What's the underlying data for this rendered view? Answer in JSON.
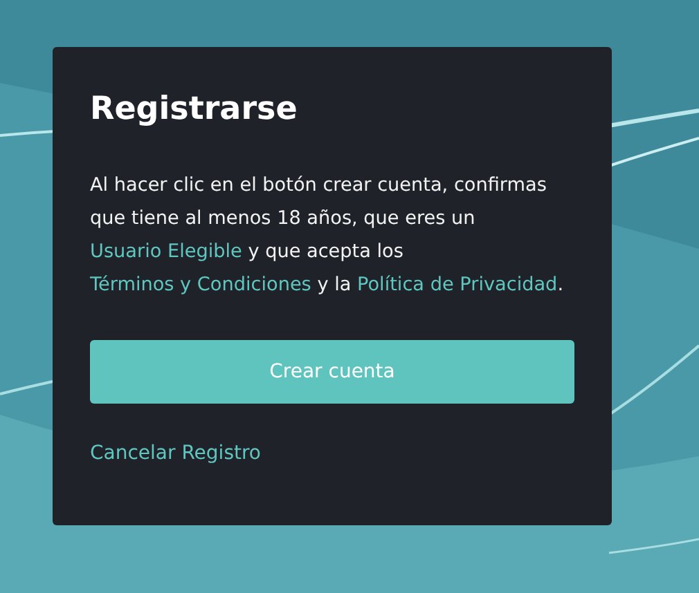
{
  "dialog": {
    "title": "Registrarse",
    "message": [
      {
        "kind": "text",
        "text": "Al hacer clic en el botón crear cuenta, confirmas que tiene al menos 18 años, que eres un "
      },
      {
        "kind": "link",
        "text": "Usuario Elegible"
      },
      {
        "kind": "text",
        "text": " y que acepta los "
      },
      {
        "kind": "link",
        "text": "Términos y Condiciones"
      },
      {
        "kind": "text",
        "text": " y la "
      },
      {
        "kind": "link",
        "text": "Política de Privacidad"
      },
      {
        "kind": "text",
        "text": "."
      }
    ],
    "primary_button": "Crear cuenta",
    "cancel_link": "Cancelar Registro"
  }
}
